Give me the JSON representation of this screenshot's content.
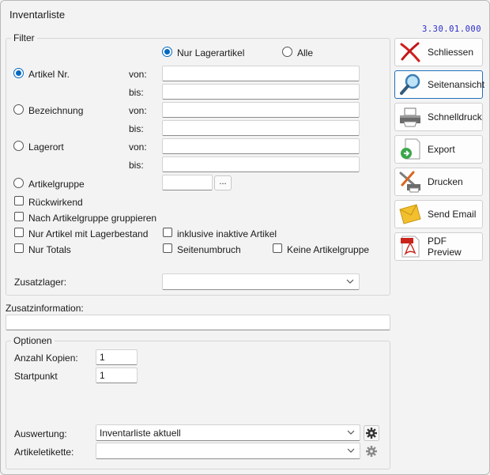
{
  "window": {
    "title": "Inventarliste",
    "version": "3.30.01.000"
  },
  "filter": {
    "legend": "Filter",
    "nur_lagerartikel": "Nur Lagerartikel",
    "alle": "Alle",
    "artikel_nr": "Artikel Nr.",
    "bezeichnung": "Bezeichnung",
    "lagerort": "Lagerort",
    "von": "von:",
    "bis": "bis:",
    "artikelgruppe": "Artikelgruppe",
    "browse": "...",
    "rueckwirkend": "Rückwirkend",
    "nach_artikelgruppe": "Nach Artikelgruppe gruppieren",
    "nur_lagerbestand": "Nur Artikel mit Lagerbestand",
    "inaktive": "inklusive inaktive Artikel",
    "nur_totals": "Nur Totals",
    "seitenumbruch": "Seitenumbruch",
    "keine_artikelgruppe": "Keine Artikelgruppe",
    "zusatzlager": "Zusatzlager:",
    "zusatzlager_value": ""
  },
  "zusatzinformation": {
    "label": "Zusatzinformation:",
    "value": ""
  },
  "optionen": {
    "legend": "Optionen",
    "anzahl_kopien_label": "Anzahl Kopien:",
    "anzahl_kopien": "1",
    "startpunkt_label": "Startpunkt",
    "startpunkt": "1",
    "auswertung_label": "Auswertung:",
    "auswertung_value": "Inventarliste aktuell",
    "artikeletikette_label": "Artikeletikette:",
    "artikeletikette_value": ""
  },
  "buttons": {
    "schliessen": "Schliessen",
    "seitenansicht": "Seitenansicht",
    "schnelldruck": "Schnelldruck",
    "export": "Export",
    "drucken": "Drucken",
    "send_email": "Send Email",
    "pdf_preview": "PDF Preview"
  },
  "state": {
    "selected_scope": "Nur Lagerartikel",
    "selected_filter": "Artikel Nr."
  },
  "colors": {
    "accent": "#0067c0",
    "version_text": "#2a2ac8"
  }
}
